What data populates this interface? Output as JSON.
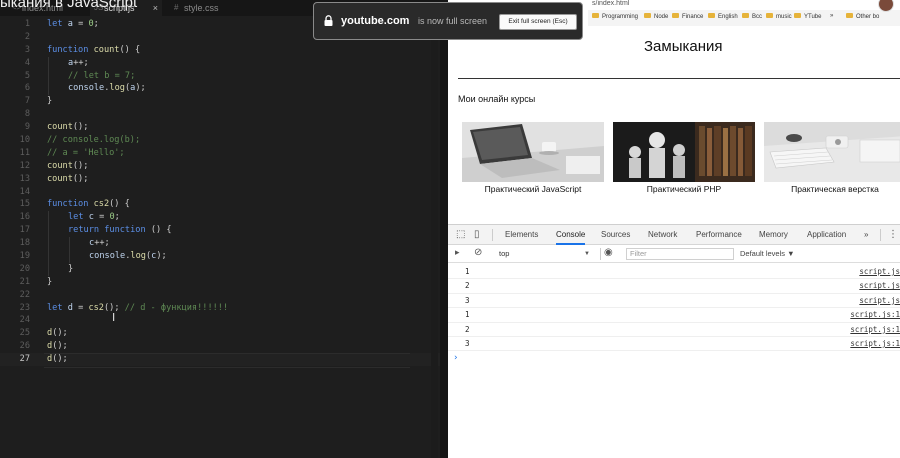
{
  "video_title": "ыкания в JavaScript",
  "editor": {
    "tabs": [
      {
        "label": "index.html",
        "icon": "html-file-icon"
      },
      {
        "label": "script.js",
        "icon": "js-file-icon",
        "active": true
      },
      {
        "label": "style.css",
        "icon": "css-file-icon"
      }
    ],
    "tab_close_glyph": "×",
    "current_line": 27,
    "lines": [
      {
        "n": "1",
        "indent": 0,
        "tokens": [
          [
            "kw",
            "let"
          ],
          [
            "op",
            " "
          ],
          [
            "id",
            "a"
          ],
          [
            "op",
            " = "
          ],
          [
            "num",
            "0"
          ],
          [
            "op",
            ";"
          ]
        ]
      },
      {
        "n": "2",
        "indent": 0,
        "tokens": []
      },
      {
        "n": "3",
        "indent": 0,
        "tokens": [
          [
            "kw",
            "function"
          ],
          [
            "op",
            " "
          ],
          [
            "fn",
            "count"
          ],
          [
            "op",
            "() {"
          ]
        ]
      },
      {
        "n": "4",
        "indent": 1,
        "tokens": [
          [
            "id",
            "a"
          ],
          [
            "op",
            "++;"
          ]
        ]
      },
      {
        "n": "5",
        "indent": 1,
        "tokens": [
          [
            "cm",
            "// let b = 7;"
          ]
        ]
      },
      {
        "n": "6",
        "indent": 1,
        "tokens": [
          [
            "id",
            "console"
          ],
          [
            "op",
            "."
          ],
          [
            "fn",
            "log"
          ],
          [
            "op",
            "("
          ],
          [
            "id",
            "a"
          ],
          [
            "op",
            ");"
          ]
        ]
      },
      {
        "n": "7",
        "indent": 0,
        "tokens": [
          [
            "op",
            "}"
          ]
        ]
      },
      {
        "n": "8",
        "indent": 0,
        "tokens": []
      },
      {
        "n": "9",
        "indent": 0,
        "tokens": [
          [
            "fn",
            "count"
          ],
          [
            "op",
            "();"
          ]
        ]
      },
      {
        "n": "10",
        "indent": 0,
        "tokens": [
          [
            "cm",
            "// console.log(b);"
          ]
        ]
      },
      {
        "n": "11",
        "indent": 0,
        "tokens": [
          [
            "cm",
            "// a = 'Hello';"
          ]
        ]
      },
      {
        "n": "12",
        "indent": 0,
        "tokens": [
          [
            "fn",
            "count"
          ],
          [
            "op",
            "();"
          ]
        ]
      },
      {
        "n": "13",
        "indent": 0,
        "tokens": [
          [
            "fn",
            "count"
          ],
          [
            "op",
            "();"
          ]
        ]
      },
      {
        "n": "14",
        "indent": 0,
        "tokens": []
      },
      {
        "n": "15",
        "indent": 0,
        "tokens": [
          [
            "kw",
            "function"
          ],
          [
            "op",
            " "
          ],
          [
            "fn",
            "cs2"
          ],
          [
            "op",
            "() {"
          ]
        ]
      },
      {
        "n": "16",
        "indent": 1,
        "tokens": [
          [
            "kw",
            "let"
          ],
          [
            "op",
            " "
          ],
          [
            "id",
            "c"
          ],
          [
            "op",
            " = "
          ],
          [
            "num",
            "0"
          ],
          [
            "op",
            ";"
          ]
        ]
      },
      {
        "n": "17",
        "indent": 1,
        "tokens": [
          [
            "kw",
            "return"
          ],
          [
            "op",
            " "
          ],
          [
            "kw",
            "function"
          ],
          [
            "op",
            " () {"
          ]
        ]
      },
      {
        "n": "18",
        "indent": 2,
        "tokens": [
          [
            "id",
            "c"
          ],
          [
            "op",
            "++;"
          ]
        ]
      },
      {
        "n": "19",
        "indent": 2,
        "tokens": [
          [
            "id",
            "console"
          ],
          [
            "op",
            "."
          ],
          [
            "fn",
            "log"
          ],
          [
            "op",
            "("
          ],
          [
            "id",
            "c"
          ],
          [
            "op",
            ");"
          ]
        ]
      },
      {
        "n": "20",
        "indent": 1,
        "tokens": [
          [
            "op",
            "}"
          ]
        ]
      },
      {
        "n": "21",
        "indent": 0,
        "tokens": [
          [
            "op",
            "}"
          ]
        ]
      },
      {
        "n": "22",
        "indent": 0,
        "tokens": []
      },
      {
        "n": "23",
        "indent": 0,
        "tokens": [
          [
            "kw",
            "let"
          ],
          [
            "op",
            " "
          ],
          [
            "id",
            "d"
          ],
          [
            "op",
            " = "
          ],
          [
            "fn",
            "cs2"
          ],
          [
            "op",
            "(); "
          ],
          [
            "cm",
            "// d - функция!!!!!!"
          ]
        ]
      },
      {
        "n": "24",
        "indent": 0,
        "tokens": []
      },
      {
        "n": "25",
        "indent": 0,
        "tokens": [
          [
            "fn",
            "d"
          ],
          [
            "op",
            "();"
          ]
        ]
      },
      {
        "n": "26",
        "indent": 0,
        "tokens": [
          [
            "fn",
            "d"
          ],
          [
            "op",
            "();"
          ]
        ]
      },
      {
        "n": "27",
        "indent": 0,
        "tokens": [
          [
            "fn",
            "d"
          ],
          [
            "op",
            "();"
          ]
        ]
      }
    ]
  },
  "browser": {
    "url_tail": "s/index.html",
    "bookmarks": [
      "Programming",
      "Node",
      "Finance",
      "English",
      "Bcc",
      "music",
      "YTube",
      "»",
      "Other bo"
    ],
    "page_title": "Замыкания",
    "courses_title": "Мои онлайн курсы",
    "courses": [
      {
        "caption": "Практический JavaScript",
        "image": "laptop-desk"
      },
      {
        "caption": "Практический PHP",
        "image": "library-busts"
      },
      {
        "caption": "Практическая верстка",
        "image": "keyboard-desk"
      }
    ]
  },
  "devtools": {
    "tabs": [
      "Elements",
      "Console",
      "Sources",
      "Network",
      "Performance",
      "Memory",
      "Application"
    ],
    "active_tab": "Console",
    "more_tabs_glyph": "»",
    "context": "top",
    "context_caret": "▼",
    "filter_placeholder": "Filter",
    "levels": "Default levels ▼",
    "console_rows": [
      {
        "value": "1",
        "source": "script.js"
      },
      {
        "value": "2",
        "source": "script.js"
      },
      {
        "value": "3",
        "source": "script.js"
      },
      {
        "value": "1",
        "source": "script.js:1"
      },
      {
        "value": "2",
        "source": "script.js:1"
      },
      {
        "value": "3",
        "source": "script.js:1"
      }
    ],
    "prompt": "›"
  },
  "fullscreen_toast": {
    "domain": "youtube.com",
    "message": "is now full screen",
    "exit_label": "Exit full screen (Esc)"
  },
  "colors": {
    "editor_bg": "#1e1e1e",
    "keyword": "#5c8fe6",
    "function": "#dcdcaa",
    "number": "#9ccc88",
    "comment": "#5f8a54",
    "devtools_accent": "#1a73e8"
  }
}
